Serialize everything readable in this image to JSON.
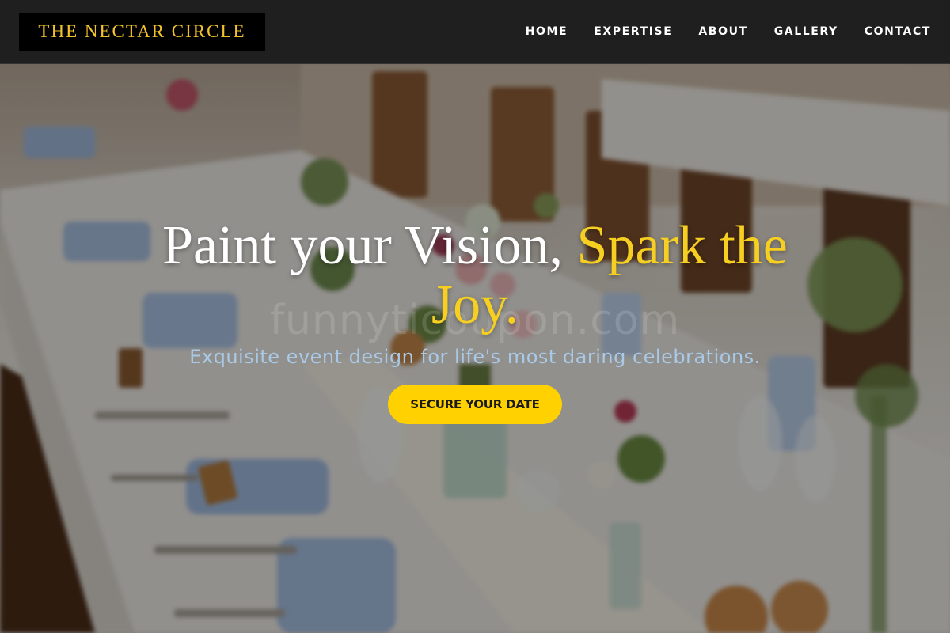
{
  "header": {
    "logo_text": "THE NECTAR CIRCLE",
    "nav": [
      {
        "label": "HOME"
      },
      {
        "label": "EXPERTISE"
      },
      {
        "label": "ABOUT"
      },
      {
        "label": "GALLERY"
      },
      {
        "label": "CONTACT"
      }
    ]
  },
  "hero": {
    "headline_part1": "Paint your Vision, ",
    "headline_part2": "Spark the Joy.",
    "subheadline": "Exquisite event design for life's most daring celebrations.",
    "cta_label": "SECURE YOUR DATE",
    "watermark_text": "funnyticoupon.com"
  },
  "colors": {
    "accent_yellow": "#f7cf21",
    "cta_background": "#ffd100",
    "subheadline_blue": "#a9c9e8",
    "header_background": "#1f1f1f"
  }
}
